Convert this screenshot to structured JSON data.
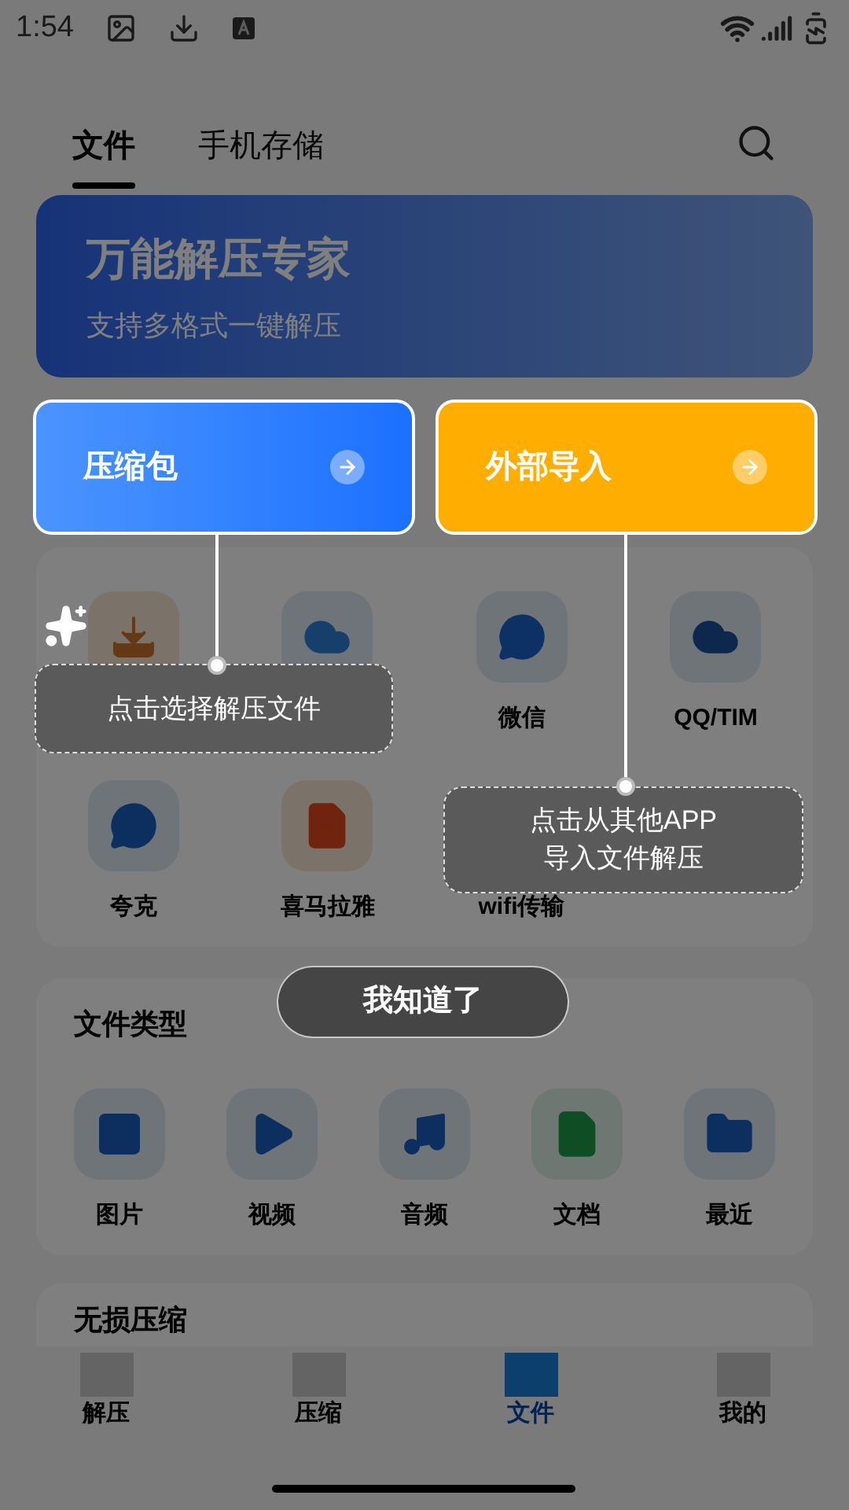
{
  "status_bar": {
    "time": "1:54"
  },
  "tabs": [
    {
      "label": "文件",
      "selected": true
    },
    {
      "label": "手机存储",
      "selected": false
    }
  ],
  "banner": {
    "title": "万能解压专家",
    "subtitle": "支持多格式一键解压"
  },
  "shortcuts": [
    {
      "kind": "download"
    },
    {
      "kind": "cloud"
    },
    {
      "label": "微信",
      "kind": "chat"
    },
    {
      "label": "QQ/TIM",
      "kind": "penguin"
    },
    {
      "label": "夸克",
      "kind": "bubble"
    },
    {
      "label": "喜马拉雅",
      "kind": "listen"
    },
    {
      "label": "wifi传输"
    }
  ],
  "file_types": {
    "title": "文件类型",
    "items": [
      {
        "label": "图片",
        "kind": "image"
      },
      {
        "label": "视频",
        "kind": "video"
      },
      {
        "label": "音频",
        "kind": "audio"
      },
      {
        "label": "文档",
        "kind": "doc"
      },
      {
        "label": "最近",
        "kind": "folder"
      }
    ]
  },
  "lossless": {
    "title": "无损压缩"
  },
  "bottom_nav": [
    {
      "label": "解压",
      "selected": false
    },
    {
      "label": "压缩",
      "selected": false
    },
    {
      "label": "文件",
      "selected": true
    },
    {
      "label": "我的",
      "selected": false
    }
  ],
  "guide": {
    "cards": [
      {
        "label": "压缩包",
        "kind": "blue"
      },
      {
        "label": "外部导入",
        "kind": "orange"
      }
    ],
    "tips": [
      {
        "lines": [
          "点击选择解压文件"
        ]
      },
      {
        "lines": [
          "点击从其他APP",
          "导入文件解压"
        ]
      }
    ],
    "button": "我知道了"
  }
}
